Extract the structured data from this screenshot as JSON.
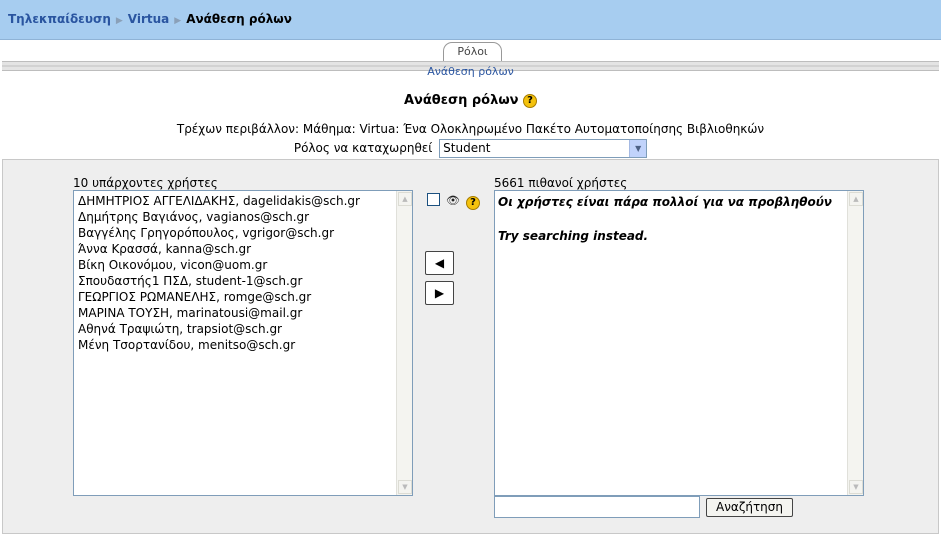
{
  "breadcrumb": {
    "items": [
      "Τηλεκπαίδευση",
      "Virtua"
    ],
    "current": "Ανάθεση ρόλων"
  },
  "tabs": {
    "main": "Ρόλοι",
    "sub": "Ανάθεση ρόλων"
  },
  "page": {
    "title": "Ανάθεση ρόλων",
    "context_text": "Τρέχων περιβάλλον: Μάθημα: Virtua: Ένα Ολοκληρωμένο Πακέτο Αυτοματοποίησης Βιβλιοθηκών",
    "role_label": "Ρόλος να καταχωρηθεί",
    "role_value": "Student"
  },
  "existing": {
    "label": "10 υπάρχοντες χρήστες",
    "users": [
      "ΔΗΜΗΤΡΙΟΣ ΑΓΓΕΛΙΔΑΚΗΣ, dagelidakis@sch.gr",
      "Δημήτρης Βαγιάνος, vagianos@sch.gr",
      "Βαγγέλης Γρηγορόπουλος, vgrigor@sch.gr",
      "Άννα Κρασσά, kanna@sch.gr",
      "Βίκη Οικονόμου, vicon@uom.gr",
      "Σπουδαστής1 ΠΣΔ, student-1@sch.gr",
      "ΓΕΩΡΓΙΟΣ ΡΩΜΑΝΕΛΗΣ, romge@sch.gr",
      "ΜΑΡΙΝΑ ΤΟΥΣΗ, marinatousi@mail.gr",
      "Αθηνά Τραψιώτη, trapsiot@sch.gr",
      "Μένη Τσορτανίδου, menitso@sch.gr"
    ]
  },
  "potential": {
    "label": "5661 πιθανοί χρήστες",
    "message": "Οι χρήστες είναι πάρα πολλοί για να προβληθούν",
    "hint": "Try searching instead."
  },
  "controls": {
    "add_arrow": "◀",
    "remove_arrow": "▶",
    "search_button": "Αναζήτηση",
    "search_value": ""
  },
  "icons": {
    "help": "?",
    "eye": "👁",
    "separator": "▶"
  },
  "colors": {
    "navbar": "#a7cdf0",
    "link": "#2a55a0",
    "panel": "#eeeeee"
  }
}
